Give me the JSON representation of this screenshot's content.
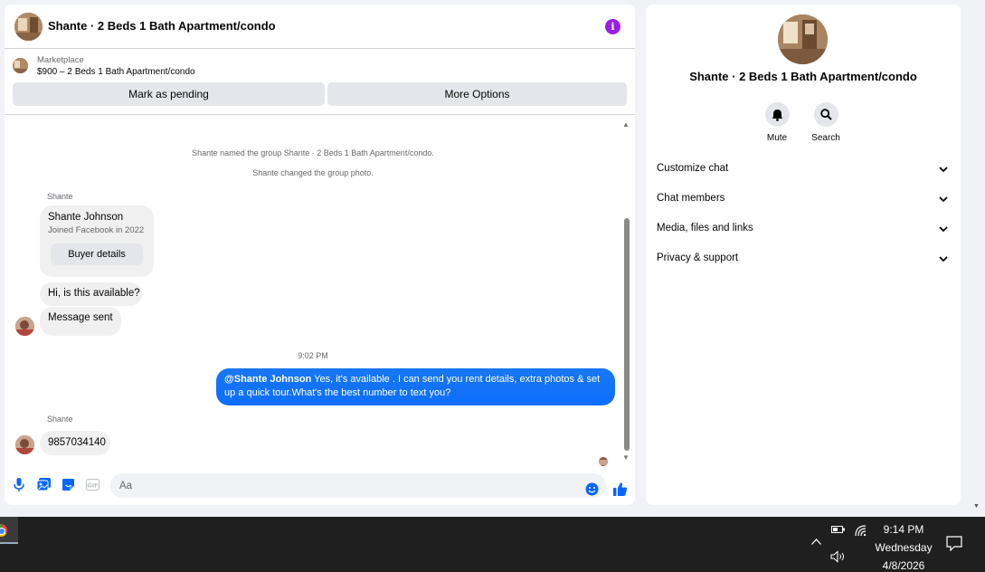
{
  "chat": {
    "title": "Shante · 2 Beds 1 Bath Apartment/condo",
    "marketplace": {
      "label": "Marketplace",
      "listing": "$900 – 2 Beds 1 Bath Apartment/condo"
    },
    "actions": {
      "pending": "Mark as pending",
      "more": "More Options"
    },
    "system_messages": [
      "Shante named the group Shante · 2 Beds 1 Bath Apartment/condo.",
      "Shante changed the group photo."
    ],
    "sender_name": "Shante",
    "profile_card": {
      "name": "Shante Johnson",
      "joined": "Joined Facebook in 2022",
      "button": "Buyer details"
    },
    "incoming_1": "Hi, is this available?",
    "incoming_2": "Message sent",
    "timestamp": "9:02 PM",
    "outgoing": {
      "mention": "@Shante Johnson",
      "line1": " Yes, it's available .  I can send you rent details, extra photos & set",
      "line2": "up a quick tour.What's the best number to text you?"
    },
    "incoming_3": "9857034140",
    "composer_placeholder": "Aa"
  },
  "info": {
    "title": "Shante · 2 Beds 1 Bath Apartment/condo",
    "quick_actions": {
      "mute": "Mute",
      "search": "Search"
    },
    "sections": [
      "Customize chat",
      "Chat members",
      "Media, files and links",
      "Privacy & support"
    ]
  },
  "taskbar": {
    "time": "9:14 PM",
    "day": "Wednesday",
    "date": "4/8/2026"
  },
  "colors": {
    "accent": "#0866ff",
    "info_button": "#9a1de8",
    "bubble_out": "#1877f2",
    "taskbar": "#1f1f1f"
  }
}
